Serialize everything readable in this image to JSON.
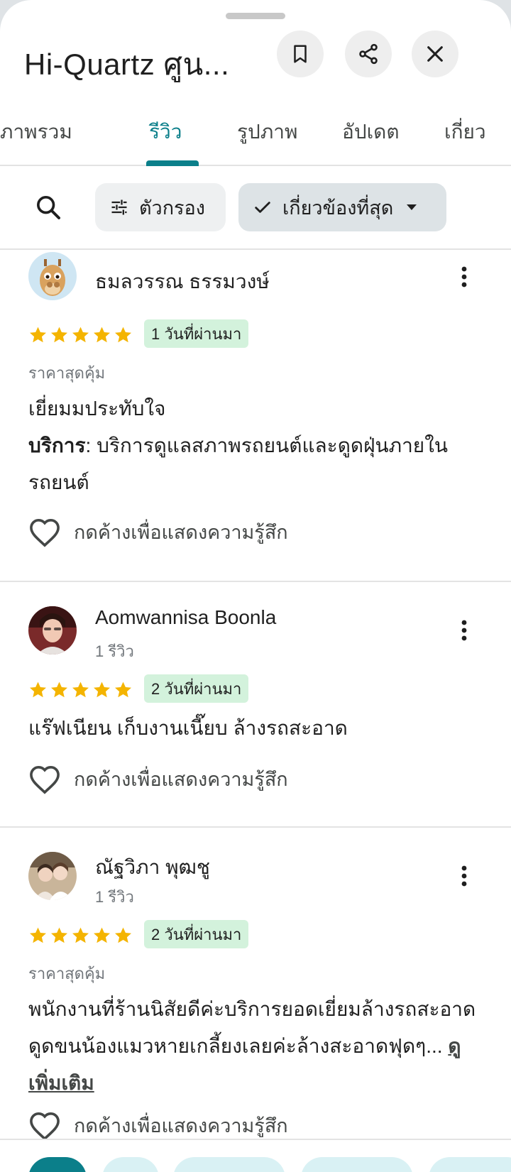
{
  "header": {
    "title": "Hi-Quartz ศูน..."
  },
  "tabs": [
    {
      "label": "ภาพรวม"
    },
    {
      "label": "รีวิว"
    },
    {
      "label": "รูปภาพ"
    },
    {
      "label": "อัปเดต"
    },
    {
      "label": "เกี่ยว"
    }
  ],
  "filters": {
    "filter_label": "ตัวกรอง",
    "sort_label": "เกี่ยวข้องที่สุด"
  },
  "colors": {
    "accent": "#0b7f8a",
    "star": "#f4b400",
    "date_badge_bg": "#d3f2dc"
  },
  "reviews": [
    {
      "name": "ธมลวรรณ ธรรมวงษ์",
      "subtitle": "",
      "rating": 5,
      "date": "1 วันที่ผ่านมา",
      "tag": "ราคาสุดคุ้ม",
      "text": "เยี่ยมมประทับใจ",
      "service_label": "บริการ",
      "service_text": ": บริการดูแลสภาพรถยนต์และดูดฝุ่นภายในรถยนต์",
      "react_label": "กดค้างเพื่อแสดงความรู้สึก"
    },
    {
      "name": "Aomwannisa Boonla",
      "subtitle": "1 รีวิว",
      "rating": 5,
      "date": "2 วันที่ผ่านมา",
      "text": "แร๊ฟเนียน เก็บงานเนี๊ยบ ล้างรถสะอาด",
      "react_label": "กดค้างเพื่อแสดงความรู้สึก"
    },
    {
      "name": "ณัฐวิภา พุฒชู",
      "subtitle": "1 รีวิว",
      "rating": 5,
      "date": "2 วันที่ผ่านมา",
      "tag": "ราคาสุดคุ้ม",
      "text": "พนักงานที่ร้านนิสัยดีค่ะบริการยอดเยี่ยมล้างรถสะอาดดูดขนน้องแมวหายเกลี้ยงเลยค่ะล้างสะอาดฟุดๆ...",
      "more_label": "ดูเพิ่มเติม",
      "react_label": "กดค้างเพื่อแสดงความรู้สึก"
    }
  ]
}
